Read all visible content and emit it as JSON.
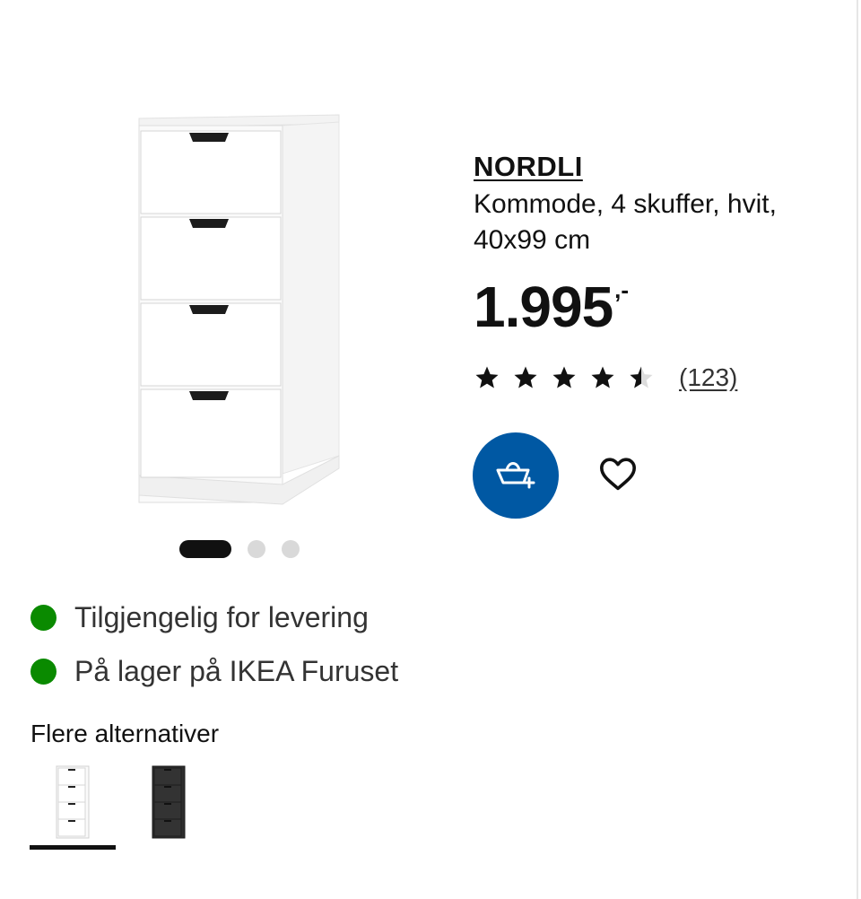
{
  "product": {
    "name": "NORDLI",
    "description": "Kommode, 4 skuffer, hvit, 40x99 cm",
    "price": "1.995",
    "price_suffix": ",-",
    "rating": 4.5,
    "rating_max": 5,
    "review_count": "(123)"
  },
  "actions": {
    "add_to_cart_icon": "cart-add-icon",
    "favourite_icon": "heart-outline-icon"
  },
  "carousel": {
    "active_index": 0,
    "total": 3
  },
  "availability": [
    {
      "text": "Tilgjengelig for levering",
      "status_color": "#0a8a00"
    },
    {
      "text": "På lager på IKEA Furuset",
      "status_color": "#0a8a00"
    }
  ],
  "variants": {
    "title": "Flere alternativer",
    "items": [
      {
        "color": "white",
        "selected": true
      },
      {
        "color": "black",
        "selected": false
      }
    ]
  },
  "colors": {
    "accent": "#0058a3",
    "in_stock": "#0a8a00",
    "text": "#111111"
  }
}
